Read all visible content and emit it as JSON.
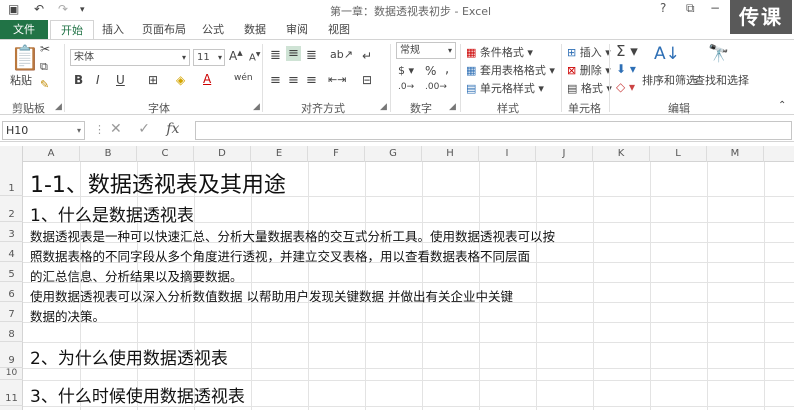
{
  "window": {
    "title": "第一章：数据透视表初步 - Excel",
    "watermark": "传课"
  },
  "qat": {
    "undo": "↶",
    "redo": "↷"
  },
  "tabs": [
    "文件",
    "开始",
    "插入",
    "页面布局",
    "公式",
    "数据",
    "审阅",
    "视图"
  ],
  "ribbon": {
    "clipboard": {
      "paste": "粘贴",
      "label": "剪贴板"
    },
    "font": {
      "name": "宋体",
      "size": "11",
      "grow": "A",
      "shrink": "A",
      "bold": "B",
      "italic": "I",
      "underline": "U",
      "wen": "wén",
      "label": "字体"
    },
    "alignment": {
      "label": "对齐方式"
    },
    "number": {
      "format": "常规",
      "percent": "%",
      "comma": ",",
      "label": "数字"
    },
    "styles": {
      "conditional": "条件格式",
      "table": "套用表格格式",
      "cell": "单元格样式",
      "label": "样式"
    },
    "cells": {
      "insert": "插入",
      "delete": "删除",
      "format": "格式",
      "label": "单元格"
    },
    "editing": {
      "sort": "排序和筛选",
      "find": "查找和选择",
      "label": "编辑"
    }
  },
  "formula_bar": {
    "cell_ref": "H10",
    "fx": "fx",
    "value": ""
  },
  "columns": [
    "A",
    "B",
    "C",
    "D",
    "E",
    "F",
    "G",
    "H",
    "I",
    "J",
    "K",
    "L",
    "M"
  ],
  "rows": [
    "1",
    "2",
    "3",
    "4",
    "5",
    "6",
    "7",
    "8",
    "9",
    "10",
    "11"
  ],
  "cells": {
    "r1": "1-1、数据透视表及其用途",
    "r2": "1、什么是数据透视表",
    "r3": "数据透视表是一种可以快速汇总、分析大量数据表格的交互式分析工具。使用数据透视表可以按",
    "r4": "照数据表格的不同字段从多个角度进行透视，并建立交叉表格，用以查看数据表格不同层面",
    "r5": "的汇总信息、分析结果以及摘要数据。",
    "r6": "使用数据透视表可以深入分析数值数据   以帮助用户发现关键数据   并做出有关企业中关键",
    "r7": "数据的决策。",
    "r9": "2、为什么使用数据透视表",
    "r11": "3、什么时候使用数据透视表"
  }
}
